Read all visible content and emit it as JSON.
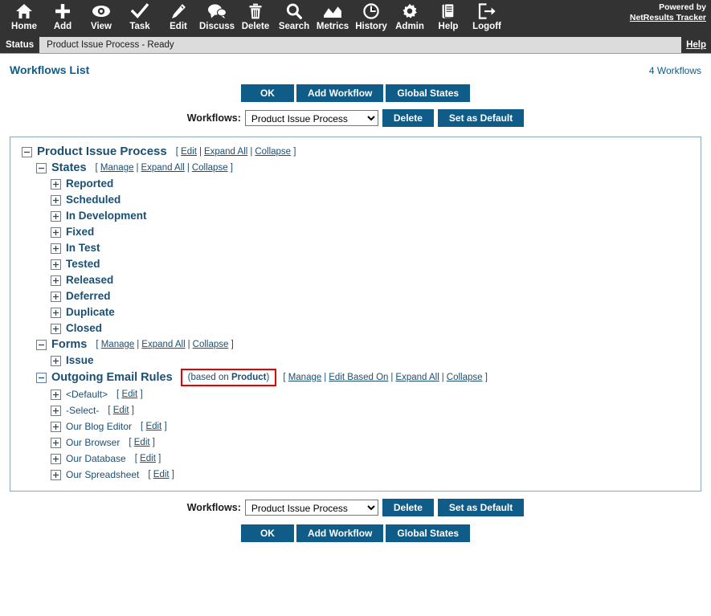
{
  "toolbar": {
    "items": [
      {
        "label": "Home",
        "icon": "home-icon"
      },
      {
        "label": "Add",
        "icon": "plus-icon"
      },
      {
        "label": "View",
        "icon": "eye-icon"
      },
      {
        "label": "Task",
        "icon": "check-icon"
      },
      {
        "label": "Edit",
        "icon": "pencil-icon"
      },
      {
        "label": "Discuss",
        "icon": "speech-bubbles-icon"
      },
      {
        "label": "Delete",
        "icon": "trash-icon"
      },
      {
        "label": "Search",
        "icon": "magnifier-icon"
      },
      {
        "label": "Metrics",
        "icon": "chart-icon"
      },
      {
        "label": "History",
        "icon": "clock-icon"
      },
      {
        "label": "Admin",
        "icon": "gear-icon"
      },
      {
        "label": "Help",
        "icon": "document-icon"
      },
      {
        "label": "Logoff",
        "icon": "exit-icon"
      }
    ],
    "powered_by": "Powered by",
    "brand": "NetResults Tracker"
  },
  "status_bar": {
    "tag": "Status",
    "text": "Product Issue Process - Ready",
    "help": "Help"
  },
  "header": {
    "title": "Workflows List",
    "count": "4 Workflows"
  },
  "buttons": {
    "ok": "OK",
    "add_workflow": "Add Workflow",
    "global_states": "Global States",
    "delete": "Delete",
    "set_as_default": "Set as Default"
  },
  "workflow_selector": {
    "label": "Workflows:",
    "selected": "Product Issue Process",
    "options": [
      "Product Issue Process"
    ]
  },
  "tree": {
    "root": {
      "label": "Product Issue Process",
      "toggle": "minus-box-icon",
      "actions": [
        "Edit",
        "Expand All",
        "Collapse"
      ]
    },
    "states_section": {
      "label": "States",
      "toggle": "minus-box-icon",
      "actions": [
        "Manage",
        "Expand All",
        "Collapse"
      ],
      "items": [
        "Reported",
        "Scheduled",
        "In Development",
        "Fixed",
        "In Test",
        "Tested",
        "Released",
        "Deferred",
        "Duplicate",
        "Closed"
      ]
    },
    "forms_section": {
      "label": "Forms",
      "toggle": "minus-box-icon",
      "actions": [
        "Manage",
        "Expand All",
        "Collapse"
      ],
      "items": [
        "Issue"
      ]
    },
    "email_section": {
      "label": "Outgoing Email Rules",
      "toggle": "minus-box-icon",
      "based_on_prefix": "(based on ",
      "based_on_value": "Product",
      "based_on_suffix": ")",
      "actions": [
        "Manage",
        "Edit Based On",
        "Expand All",
        "Collapse"
      ],
      "items": [
        {
          "label": "<Default>",
          "action": "Edit"
        },
        {
          "label": "-Select-",
          "action": "Edit"
        },
        {
          "label": "Our Blog Editor",
          "action": "Edit"
        },
        {
          "label": "Our Browser",
          "action": "Edit"
        },
        {
          "label": "Our Database",
          "action": "Edit"
        },
        {
          "label": "Our Spreadsheet",
          "action": "Edit"
        }
      ]
    }
  },
  "colors": {
    "toolbar_bg": "#333333",
    "accent_blue": "#0e5c87",
    "tree_text": "#1b4f72",
    "highlight_red": "#e60000",
    "statusbar_bg": "#dcdcdc"
  }
}
